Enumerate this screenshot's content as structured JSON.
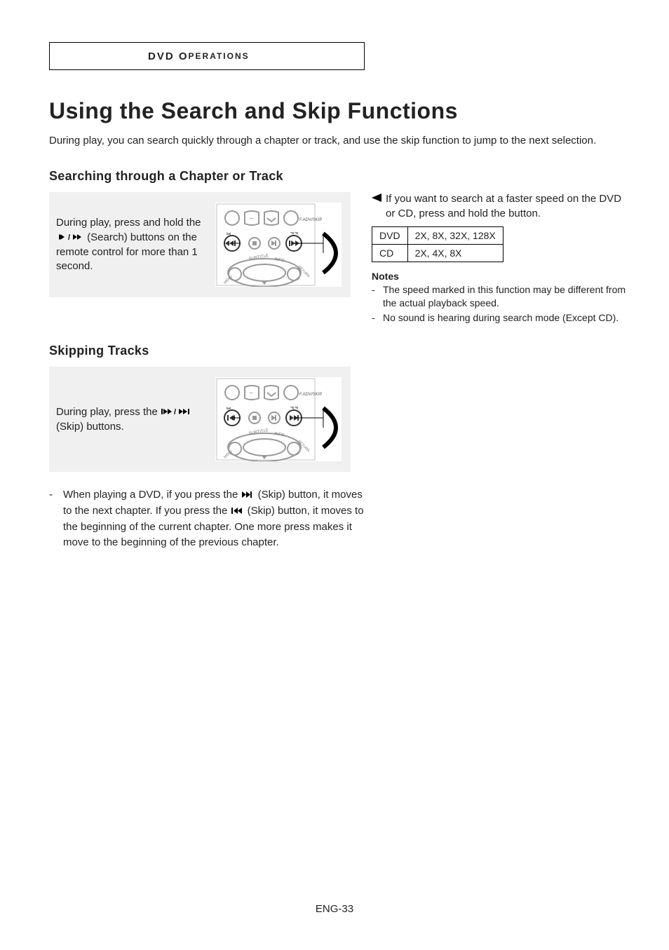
{
  "header": {
    "title_main": "DVD O",
    "title_small": "PERATIONS"
  },
  "main": {
    "title": "Using the Search and Skip Functions",
    "intro": "During play, you can search quickly through a chapter or track, and use the skip function to jump to the next selection."
  },
  "section1": {
    "heading": "Searching through a Chapter or Track",
    "left_pre": "During play, press and hold the",
    "left_post": "(Search) buttons on the remote control for more than 1 second.",
    "right_line1": "If you want to search at a faster speed on the DVD or CD, press and hold the button.",
    "speed_table": [
      {
        "medium": "DVD",
        "speeds": "2X, 8X, 32X, 128X"
      },
      {
        "medium": "CD",
        "speeds": "2X, 4X, 8X"
      }
    ],
    "notes_head": "Notes",
    "notes": [
      "The speed marked in this function may be different from the actual playback speed.",
      "No sound is hearing during search mode (Except CD)."
    ]
  },
  "section2": {
    "heading": "Skipping Tracks",
    "left_pre": "During play, press the",
    "left_post": "(Skip) buttons.",
    "explain_pre": "When playing a DVD, if you press the",
    "explain_mid1": "(Skip) button, it moves to the next chapter. If you press the",
    "explain_mid2": "(Skip) button, it moves to the beginning of the current chapter. One more press makes it move to the beginning of the previous chapter."
  },
  "chart_data": {
    "type": "table",
    "title": "Search speed by disc type",
    "series": [
      {
        "name": "DVD",
        "values": [
          "2X",
          "8X",
          "32X",
          "128X"
        ]
      },
      {
        "name": "CD",
        "values": [
          "2X",
          "4X",
          "8X"
        ]
      }
    ]
  },
  "footer": "ENG-33"
}
